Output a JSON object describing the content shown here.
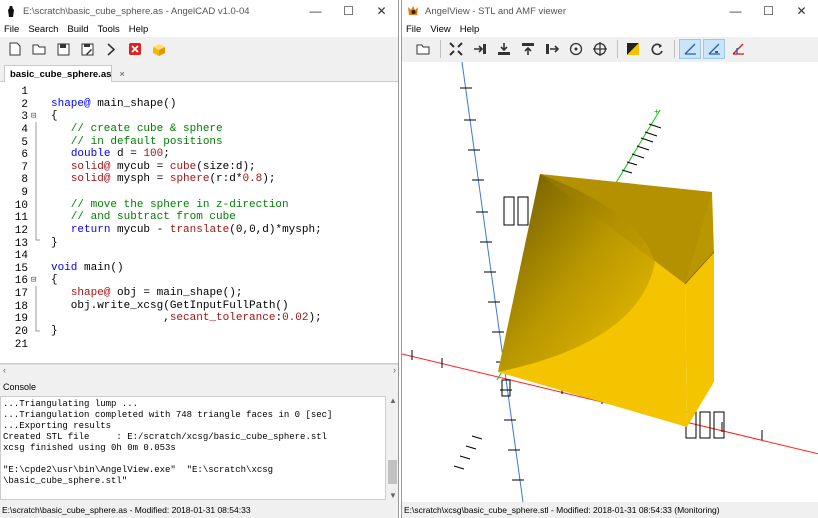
{
  "editor_window": {
    "title": "E:\\scratch\\basic_cube_sphere.as - AngelCAD v1.0-04",
    "menu": [
      "File",
      "Search",
      "Build",
      "Tools",
      "Help"
    ],
    "toolbar_icons": [
      "new-file-icon",
      "open-folder-icon",
      "save-icon",
      "save-as-icon",
      "run-icon",
      "stop-icon",
      "cube-icon"
    ],
    "tab_label": "basic_cube_sphere.as",
    "tab_close": "×",
    "line_numbers": [
      "1",
      "2",
      "3",
      "4",
      "5",
      "6",
      "7",
      "8",
      "9",
      "10",
      "11",
      "12",
      "13",
      "14",
      "15",
      "16",
      "17",
      "18",
      "19",
      "20",
      "21"
    ],
    "code_lines": [
      "",
      "shape@ main_shape()",
      "{",
      "   // create cube & sphere",
      "   // in default positions",
      "   double d = 100;",
      "   solid@ mycub = cube(size:d);",
      "   solid@ mysph = sphere(r:d*0.8);",
      "",
      "   // move the sphere in z-direction",
      "   // and subtract from cube",
      "   return mycub - translate(0,0,d)*mysph;",
      "}",
      "",
      "void main()",
      "{",
      "   shape@ obj = main_shape();",
      "   obj.write_xcsg(GetInputFullPath()",
      "                 ,secant_tolerance:0.02);",
      "}",
      ""
    ],
    "console_label": "Console",
    "console_lines": [
      "...Triangulating lump ...",
      "...Triangulation completed with 748 triangle faces in 0 [sec]",
      "...Exporting results",
      "Created STL file     : E:/scratch/xcsg/basic_cube_sphere.stl",
      "xcsg finished using 0h 0m 0.053s",
      "",
      "\"E:\\cpde2\\usr\\bin\\AngelView.exe\"  \"E:\\scratch\\xcsg",
      "\\basic_cube_sphere.stl\""
    ],
    "status": "E:\\scratch\\basic_cube_sphere.as - Modified: 2018-01-31 08:54:33"
  },
  "viewer_window": {
    "title": "AngelView - STL and AMF viewer",
    "menu": [
      "File",
      "View",
      "Help"
    ],
    "toolbar_icons": [
      "open-icon",
      "fit-view-icon",
      "import-icon",
      "download-icon",
      "upload-icon",
      "export-icon",
      "center-icon",
      "crosshair-icon",
      "shading-icon",
      "rotate-icon",
      "axes-icon",
      "axes-labeled-icon",
      "axes-colored-icon"
    ],
    "status": "E:\\scratch\\xcsg\\basic_cube_sphere.stl - Modified: 2018-01-31 08:54:33 (Monitoring)"
  },
  "window_controls": {
    "minimize": "—",
    "maximize": "☐",
    "close": "✕"
  },
  "colors": {
    "model_yellow": "#f5c400",
    "model_shadow": "#a88800",
    "keyword_blue": "#0000ff",
    "comment_green": "#008000",
    "axis_red": "#ff0000",
    "axis_green": "#00cc00",
    "axis_blue": "#3a7bd5"
  }
}
